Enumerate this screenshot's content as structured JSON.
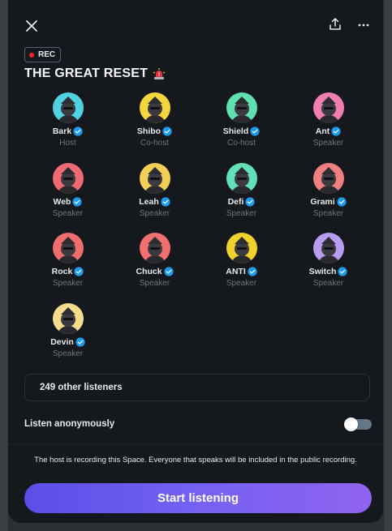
{
  "space": {
    "rec_label": "REC",
    "title": "THE GREAT RESET"
  },
  "icons": {
    "close": "close-icon",
    "share": "share-icon",
    "more": "more-icon",
    "title_emoji": "siren-icon",
    "verified": "verified-badge-icon"
  },
  "participants": [
    {
      "name": "Bark",
      "role": "Host",
      "color": "#4fd3e0"
    },
    {
      "name": "Shibo",
      "role": "Co-host",
      "color": "#f5d63c"
    },
    {
      "name": "Shield",
      "role": "Co-host",
      "color": "#5fe0b0"
    },
    {
      "name": "Ant",
      "role": "Speaker",
      "color": "#f07fb0"
    },
    {
      "name": "Web",
      "role": "Speaker",
      "color": "#f06a73"
    },
    {
      "name": "Leah",
      "role": "Speaker",
      "color": "#f4cf55"
    },
    {
      "name": "Defi",
      "role": "Speaker",
      "color": "#62e0b8"
    },
    {
      "name": "Grami",
      "role": "Speaker",
      "color": "#f07f7f"
    },
    {
      "name": "Rock",
      "role": "Speaker",
      "color": "#f06d6d"
    },
    {
      "name": "Chuck",
      "role": "Speaker",
      "color": "#f07070"
    },
    {
      "name": "ANTI",
      "role": "Speaker",
      "color": "#f0d22a"
    },
    {
      "name": "Switch",
      "role": "Speaker",
      "color": "#b79cf0"
    },
    {
      "name": "Devin",
      "role": "Speaker",
      "color": "#f3dc8a"
    }
  ],
  "listeners": {
    "label": "249 other listeners"
  },
  "anonymous": {
    "label": "Listen anonymously",
    "enabled": false
  },
  "notice": "The host is recording this Space. Everyone that speaks will be included in the public recording.",
  "cta": {
    "label": "Start listening"
  },
  "colors": {
    "modal_bg": "#15181c",
    "verified": "#1d9bf0",
    "rec_dot": "#f4212e",
    "cta_start": "#5b4ee8",
    "cta_end": "#8f63f0"
  }
}
